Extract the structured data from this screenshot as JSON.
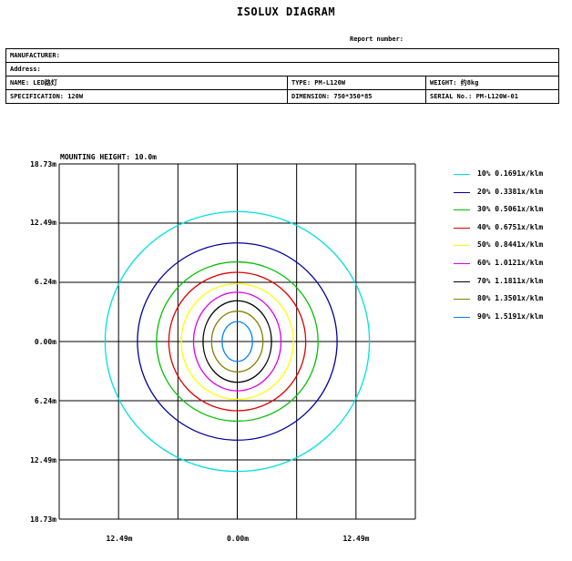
{
  "header": {
    "title": "ISOLUX DIAGRAM",
    "report_number_label": "Report number:"
  },
  "info": {
    "manufacturer": "MANUFACTURER:",
    "address": "Address:",
    "name": "NAME: LED路灯",
    "type": "TYPE: PM-L120W",
    "weight": "WEIGHT: 约8kg",
    "specification": "SPECIFICATION: 120W",
    "dimension": "DIMENSION: 750*350*85",
    "serial": "SERIAL No.: PM-L120W-01"
  },
  "chart_data": {
    "type": "contour",
    "title": "MOUNTING HEIGHT: 10.0m",
    "y_tick_labels": [
      "18.73m",
      "12.49m",
      "6.24m",
      "0.00m",
      "6.24m",
      "12.49m",
      "18.73m"
    ],
    "x_tick_labels": [
      "12.49m",
      "0.00m",
      "12.49m"
    ],
    "x_range_m": [
      -18.73,
      18.73
    ],
    "y_range_m": [
      -18.73,
      18.73
    ],
    "grid": true,
    "legend_position": "right",
    "series": [
      {
        "label": "10% 0.1691x/klm",
        "color": "#00e0e0",
        "rx_m": 13.9,
        "ry_m": 13.7
      },
      {
        "label": "20% 0.3381x/klm",
        "color": "#0000a0",
        "rx_m": 10.5,
        "ry_m": 10.4
      },
      {
        "label": "30% 0.5061x/klm",
        "color": "#00c000",
        "rx_m": 8.5,
        "ry_m": 8.4
      },
      {
        "label": "40% 0.6751x/klm",
        "color": "#e00000",
        "rx_m": 7.2,
        "ry_m": 7.3
      },
      {
        "label": "50% 0.8441x/klm",
        "color": "#ffff00",
        "rx_m": 5.9,
        "ry_m": 6.1
      },
      {
        "label": "60% 1.0121x/klm",
        "color": "#e000e0",
        "rx_m": 4.6,
        "ry_m": 5.2
      },
      {
        "label": "70% 1.1811x/klm",
        "color": "#000000",
        "rx_m": 3.6,
        "ry_m": 4.3
      },
      {
        "label": "80% 1.3501x/klm",
        "color": "#808000",
        "rx_m": 2.7,
        "ry_m": 3.2
      },
      {
        "label": "90% 1.5191x/klm",
        "color": "#0080ff",
        "rx_m": 1.6,
        "ry_m": 2.1
      }
    ]
  }
}
